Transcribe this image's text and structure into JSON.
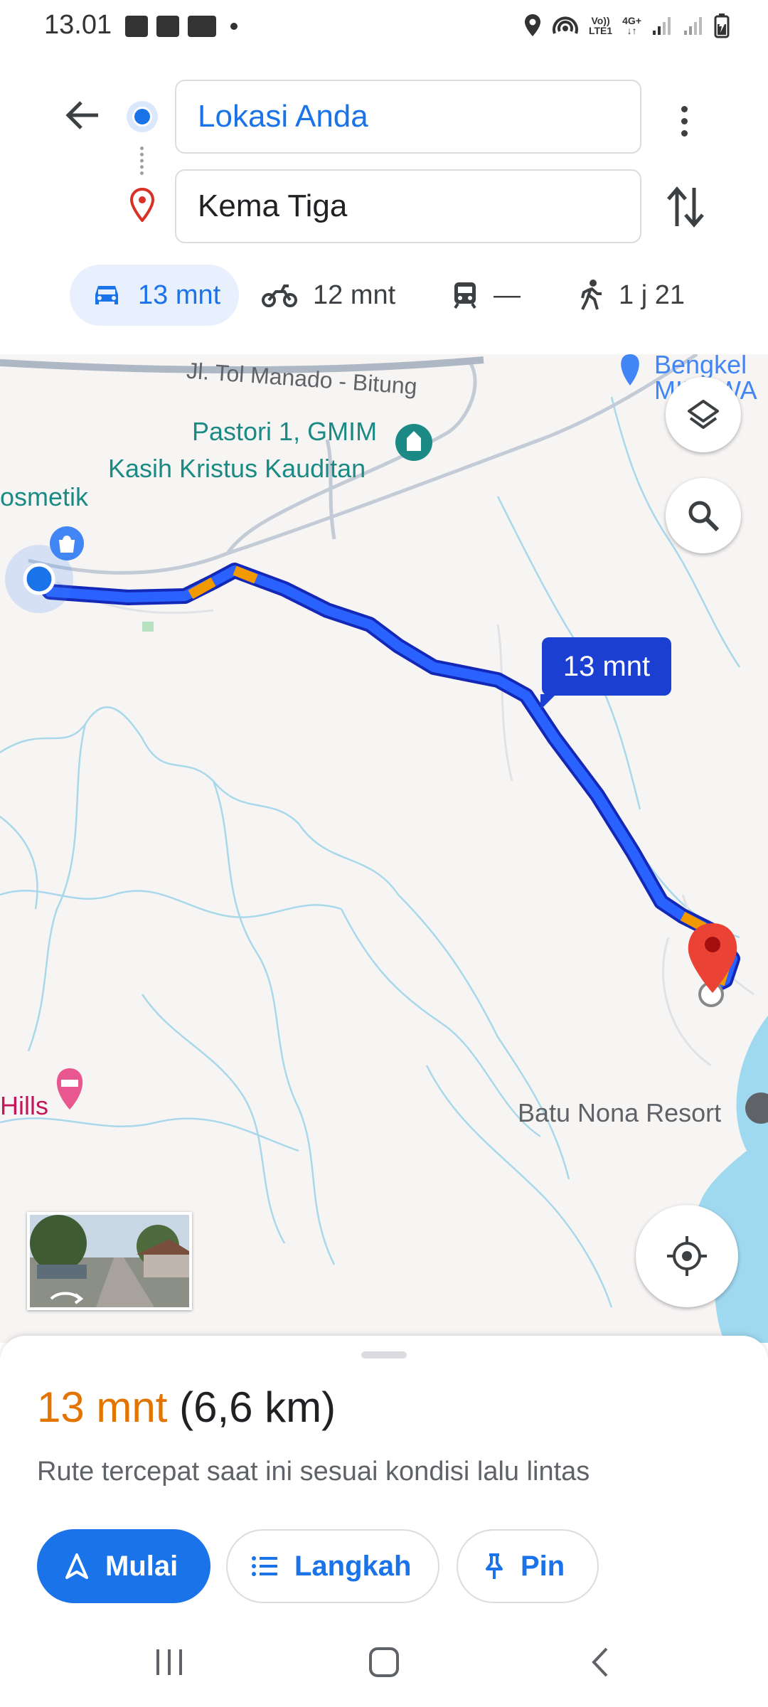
{
  "status_bar": {
    "time": "13.01",
    "volte_top": "Vo))",
    "volte_bottom": "LTE1",
    "network_top": "4G+",
    "network_bottom": "↓↑"
  },
  "directions": {
    "origin": "Lokasi Anda",
    "destination": "Kema Tiga",
    "modes": [
      {
        "icon": "car-icon",
        "label": "13 mnt",
        "active": true
      },
      {
        "icon": "motorcycle-icon",
        "label": "12 mnt",
        "active": false
      },
      {
        "icon": "transit-icon",
        "label": "—",
        "active": false
      },
      {
        "icon": "walk-icon",
        "label": "1 j 21",
        "active": false
      }
    ]
  },
  "map": {
    "road_label": "Jl. Tol Manado - Bitung",
    "poi_pastori_line1": "Pastori 1, GMIM",
    "poi_pastori_line2": "Kasih Kristus Kauditan",
    "poi_kosmetik": "osmetik",
    "poi_hills": "Hills",
    "poi_resort": "Batu Nona Resort",
    "poi_top_right_line1": "Bengkel",
    "poi_top_right_line2": "MIRZWA",
    "eta_bubble": "13 mnt",
    "route_color": "#1a3fd1",
    "traffic_color": "#f29900"
  },
  "sheet": {
    "duration": "13 mnt",
    "distance": "(6,6 km)",
    "description": "Rute tercepat saat ini sesuai kondisi lalu lintas",
    "start_label": "Mulai",
    "steps_label": "Langkah",
    "pin_label": "Pin"
  }
}
